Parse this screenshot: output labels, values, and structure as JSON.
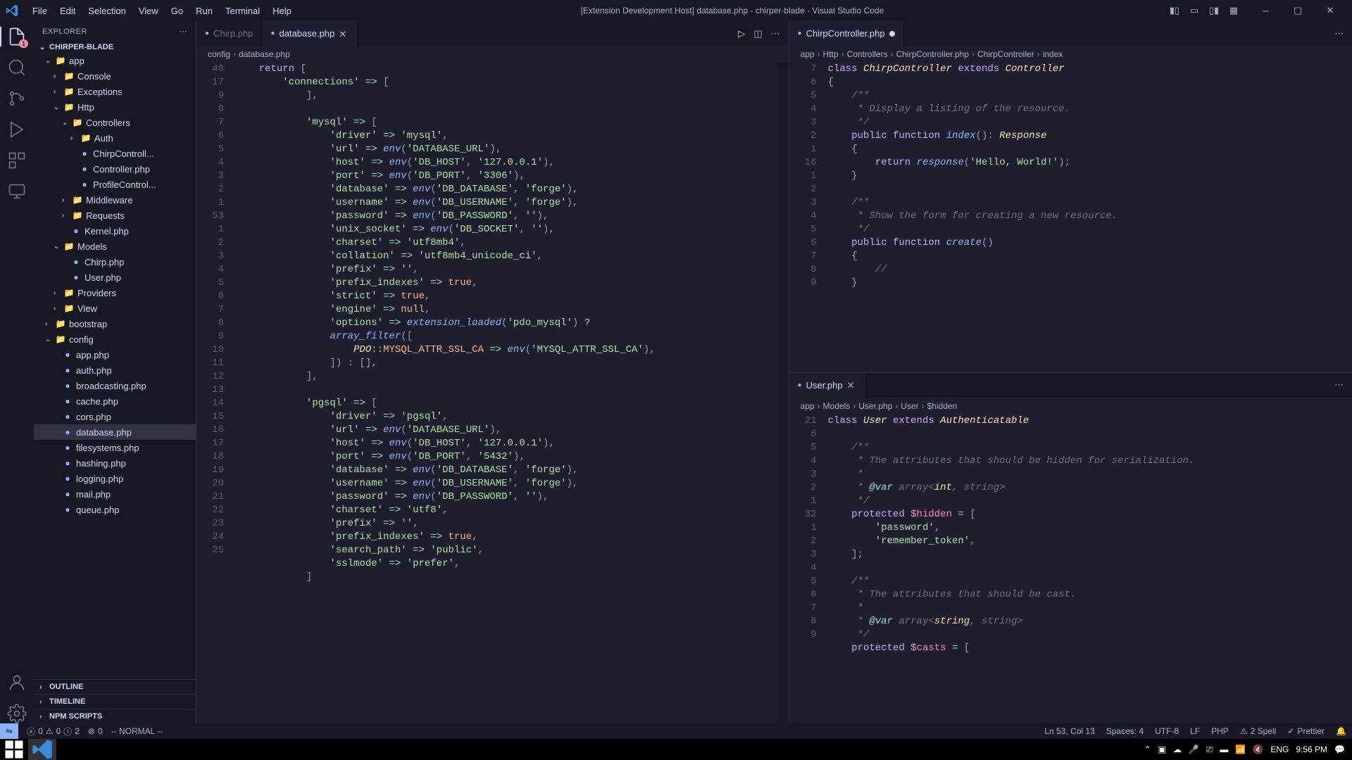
{
  "title": "[Extension Development Host] database.php - chirper-blade - Visual Studio Code",
  "menu": [
    "File",
    "Edit",
    "Selection",
    "View",
    "Go",
    "Run",
    "Terminal",
    "Help"
  ],
  "explorer": {
    "title": "EXPLORER",
    "root": "CHIRPER-BLADE",
    "outline": "OUTLINE",
    "timeline": "TIMELINE",
    "npm": "NPM SCRIPTS"
  },
  "tree": [
    {
      "indent": 1,
      "type": "folder",
      "open": true,
      "name": "app",
      "icon": "red"
    },
    {
      "indent": 2,
      "type": "folder",
      "open": false,
      "name": "Console"
    },
    {
      "indent": 2,
      "type": "folder",
      "open": false,
      "name": "Exceptions"
    },
    {
      "indent": 2,
      "type": "folder",
      "open": true,
      "name": "Http"
    },
    {
      "indent": 3,
      "type": "folder",
      "open": true,
      "name": "Controllers"
    },
    {
      "indent": 4,
      "type": "folder",
      "open": false,
      "name": "Auth"
    },
    {
      "indent": 4,
      "type": "file",
      "name": "ChirpControll..."
    },
    {
      "indent": 4,
      "type": "file",
      "name": "Controller.php"
    },
    {
      "indent": 4,
      "type": "file",
      "name": "ProfileControl..."
    },
    {
      "indent": 3,
      "type": "folder",
      "open": false,
      "name": "Middleware",
      "icon": "purple"
    },
    {
      "indent": 3,
      "type": "folder",
      "open": false,
      "name": "Requests"
    },
    {
      "indent": 3,
      "type": "file",
      "name": "Kernel.php"
    },
    {
      "indent": 2,
      "type": "folder",
      "open": true,
      "name": "Models"
    },
    {
      "indent": 3,
      "type": "file",
      "name": "Chirp.php"
    },
    {
      "indent": 3,
      "type": "file",
      "name": "User.php"
    },
    {
      "indent": 2,
      "type": "folder",
      "open": false,
      "name": "Providers"
    },
    {
      "indent": 2,
      "type": "folder",
      "open": false,
      "name": "View"
    },
    {
      "indent": 1,
      "type": "folder",
      "open": false,
      "name": "bootstrap"
    },
    {
      "indent": 1,
      "type": "folder",
      "open": true,
      "name": "config"
    },
    {
      "indent": 2,
      "type": "file",
      "name": "app.php"
    },
    {
      "indent": 2,
      "type": "file",
      "name": "auth.php"
    },
    {
      "indent": 2,
      "type": "file",
      "name": "broadcasting.php"
    },
    {
      "indent": 2,
      "type": "file",
      "name": "cache.php"
    },
    {
      "indent": 2,
      "type": "file",
      "name": "cors.php"
    },
    {
      "indent": 2,
      "type": "file",
      "name": "database.php",
      "active": true
    },
    {
      "indent": 2,
      "type": "file",
      "name": "filesystems.php"
    },
    {
      "indent": 2,
      "type": "file",
      "name": "hashing.php"
    },
    {
      "indent": 2,
      "type": "file",
      "name": "logging.php"
    },
    {
      "indent": 2,
      "type": "file",
      "name": "mail.php"
    },
    {
      "indent": 2,
      "type": "file",
      "name": "queue.php"
    }
  ],
  "tabs_left": [
    {
      "name": "Chirp.php",
      "active": false
    },
    {
      "name": "database.php",
      "active": true,
      "close": true
    }
  ],
  "tabs_right_top": [
    {
      "name": "ChirpController.php",
      "active": true,
      "dirty": true
    }
  ],
  "tabs_right_bottom": [
    {
      "name": "User.php",
      "active": true,
      "close": true
    }
  ],
  "breadcrumbs_left": [
    "config",
    "database.php"
  ],
  "breadcrumbs_right_top": [
    "app",
    "Http",
    "Controllers",
    "ChirpController.php",
    "ChirpController",
    "index"
  ],
  "breadcrumbs_right_bottom": [
    "app",
    "Models",
    "User.php",
    "User",
    "$hidden"
  ],
  "gutter_left": [
    "48",
    "17",
    "9",
    "8",
    "7",
    "6",
    "5",
    "4",
    "3",
    "2",
    "1",
    "53",
    "1",
    "2",
    "3",
    "4",
    "5",
    "6",
    "7",
    "8",
    "",
    "9",
    "10",
    "11",
    "12",
    "13",
    "14",
    "15",
    "16",
    "17",
    "18",
    "19",
    "20",
    "21",
    "22",
    "23",
    "24",
    "25",
    ""
  ],
  "gutter_rt": [
    "7",
    "6",
    "5",
    "4",
    "3",
    "2",
    "1",
    "16",
    "1",
    "2",
    "3",
    "4",
    "5",
    "6",
    "7",
    "8",
    "9"
  ],
  "gutter_rb": [
    "21",
    "",
    "6",
    "5",
    "4",
    "3",
    "2",
    "1",
    "32",
    "1",
    "2",
    "3",
    "4",
    "5",
    "6",
    "7",
    "8",
    "9"
  ],
  "statusbar": {
    "errors": "0",
    "warnings": "0",
    "info": "2",
    "ports": "0",
    "mode": "-- NORMAL --",
    "position": "Ln 53, Col 13",
    "spaces": "Spaces: 4",
    "encoding": "UTF-8",
    "eol": "LF",
    "lang": "PHP",
    "spell": "2 Spell",
    "prettier": "Prettier"
  },
  "taskbar": {
    "lang": "ENG",
    "time": "9:56 PM"
  }
}
